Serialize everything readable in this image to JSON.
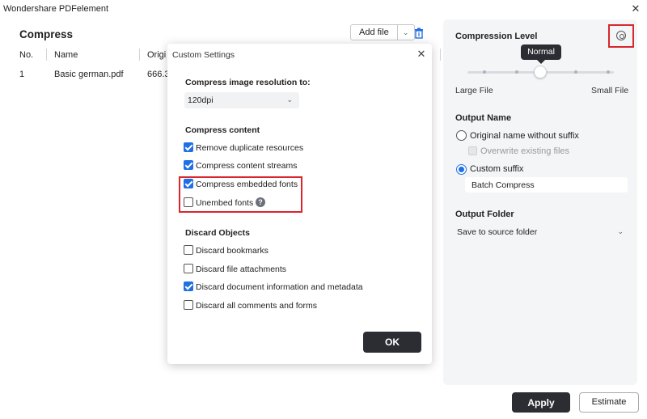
{
  "window": {
    "title": "Wondershare PDFelement",
    "close_glyph": "✕"
  },
  "main": {
    "title": "Compress",
    "add_file_label": "Add file",
    "columns": [
      "No.",
      "Name",
      "Origi"
    ],
    "rows": [
      {
        "no": "1",
        "name": "Basic german.pdf",
        "original": "666.3"
      }
    ]
  },
  "right_panel": {
    "compression_level": {
      "heading": "Compression Level",
      "tooltip": "Normal",
      "value_fraction": 0.5,
      "left_label": "Large File",
      "right_label": "Small File"
    },
    "output_name": {
      "heading": "Output Name",
      "option_original": "Original name without suffix",
      "overwrite_label": "Overwrite existing files",
      "option_custom": "Custom suffix",
      "selected": "Custom suffix",
      "suffix_value": "Batch Compress"
    },
    "output_folder": {
      "heading": "Output Folder",
      "value": "Save to source folder"
    },
    "apply_label": "Apply",
    "estimate_label": "Estimate"
  },
  "dialog": {
    "title": "Custom Settings",
    "resolution_heading": "Compress image resolution to:",
    "resolution_value": "120dpi",
    "content_heading": "Compress content",
    "content_options": [
      {
        "label": "Remove duplicate resources",
        "checked": true
      },
      {
        "label": "Compress content streams",
        "checked": true
      },
      {
        "label": "Compress embedded fonts",
        "checked": true
      },
      {
        "label": "Unembed fonts",
        "checked": false
      }
    ],
    "discard_heading": "Discard Objects",
    "discard_options": [
      {
        "label": "Discard bookmarks",
        "checked": false
      },
      {
        "label": "Discard file attachments",
        "checked": false
      },
      {
        "label": "Discard document information and metadata",
        "checked": true
      },
      {
        "label": "Discard all comments and forms",
        "checked": false
      }
    ],
    "ok_label": "OK"
  },
  "colors": {
    "accent": "#1f6fe5",
    "dark_button": "#2b2d33",
    "highlight": "#d9262d"
  },
  "icons": [
    "close-icon",
    "chevron-down-icon",
    "trash-icon",
    "settings-icon",
    "help-icon",
    "check-icon"
  ]
}
